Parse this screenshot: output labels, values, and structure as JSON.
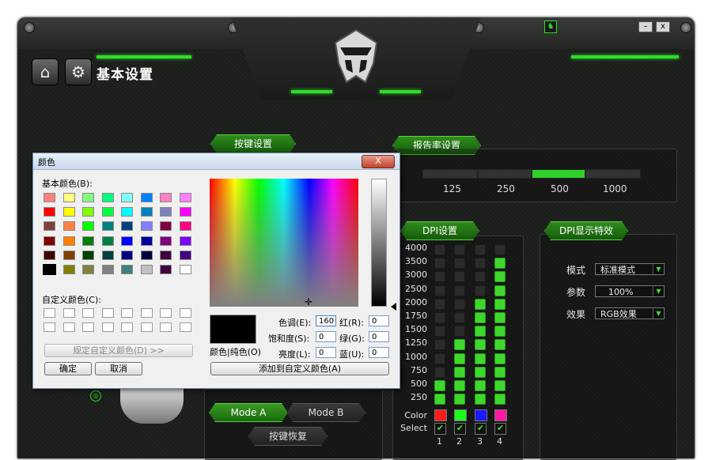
{
  "app": {
    "page_title": "基本设置",
    "window_controls": {
      "minimize": "–",
      "close": "x"
    },
    "colors": {
      "accent": "#2fdc2a",
      "panel_bg": "#1b1d1b"
    }
  },
  "sections": {
    "key_settings": "按键设置",
    "report_rate": "报告率设置",
    "dpi_settings": "DPI设置",
    "dpi_effect": "DPI显示特效"
  },
  "report_rate": {
    "options": [
      "125",
      "250",
      "500",
      "1000"
    ],
    "selected": "500"
  },
  "dpi": {
    "levels": [
      "4000",
      "3500",
      "3000",
      "2500",
      "2000",
      "1750",
      "1500",
      "1250",
      "1000",
      "750",
      "500",
      "250"
    ],
    "columns": [
      {
        "number": "1",
        "filled_levels": 2,
        "color": "#ff1a1a",
        "selected_mark": "✔"
      },
      {
        "number": "2",
        "filled_levels": 5,
        "color": "#1aff1a",
        "selected_mark": "✔"
      },
      {
        "number": "3",
        "filled_levels": 8,
        "color": "#1a1aff",
        "selected_mark": "✔"
      },
      {
        "number": "4",
        "filled_levels": 11,
        "color": "#ff1aa0",
        "selected_mark": "✔"
      }
    ],
    "color_label": "Color",
    "select_label": "Select"
  },
  "effects": {
    "mode_label": "模式",
    "mode_value": "标准模式",
    "param_label": "参数",
    "param_value": "100%",
    "effect_label": "效果",
    "effect_value": "RGB效果"
  },
  "buttons": {
    "mode_a": "Mode A",
    "mode_b": "Mode B",
    "key_reset": "按键恢复"
  },
  "dialog": {
    "title": "颜色",
    "close": "X",
    "basic_colors_label": "基本颜色(B):",
    "custom_colors_label": "自定义颜色(C):",
    "define_custom_button": "规定自定义颜色(D) >>",
    "ok_button": "确定",
    "cancel_button": "取消",
    "color_solid_label": "颜色|纯色(O)",
    "add_custom_button": "添加到自定义颜色(A)",
    "hue_label": "色调(E):",
    "hue_value": "160",
    "sat_label": "饱和度(S):",
    "sat_value": "0",
    "lum_label": "亮度(L):",
    "lum_value": "0",
    "red_label": "红(R):",
    "red_value": "0",
    "green_label": "绿(G):",
    "green_value": "0",
    "blue_label": "蓝(U):",
    "blue_value": "0",
    "basic_colors": [
      [
        "#ff8080",
        "#ffff80",
        "#80ff80",
        "#00ff80",
        "#80ffff",
        "#0080ff",
        "#ff80c0",
        "#ff80ff"
      ],
      [
        "#ff0000",
        "#ffff00",
        "#80ff00",
        "#00ff40",
        "#00ffff",
        "#0080c0",
        "#8080c0",
        "#ff00ff"
      ],
      [
        "#804040",
        "#ff8040",
        "#00ff00",
        "#008080",
        "#004080",
        "#8080ff",
        "#800040",
        "#ff0080"
      ],
      [
        "#800000",
        "#ff8000",
        "#008000",
        "#008040",
        "#0000ff",
        "#0000a0",
        "#800080",
        "#8000ff"
      ],
      [
        "#400000",
        "#804000",
        "#004000",
        "#004040",
        "#000080",
        "#000040",
        "#400040",
        "#400080"
      ],
      [
        "#000000",
        "#808000",
        "#808040",
        "#808080",
        "#408080",
        "#c0c0c0",
        "#400040",
        "#ffffff"
      ]
    ]
  }
}
